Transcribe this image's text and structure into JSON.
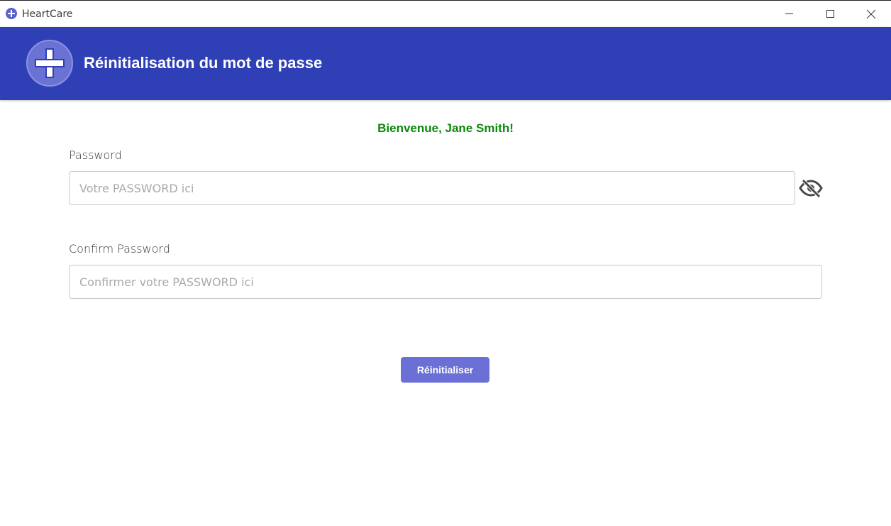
{
  "window": {
    "app_title": "HeartCare"
  },
  "header": {
    "title": "Réinitialisation du mot de passe"
  },
  "content": {
    "welcome_text": "Bienvenue, Jane Smith!",
    "password": {
      "label": "Password",
      "placeholder": "Votre PASSWORD ici",
      "value": ""
    },
    "confirm_password": {
      "label": "Confirm Password",
      "placeholder": "Confirmer votre PASSWORD ici",
      "value": ""
    },
    "submit_label": "Réinitialiser"
  },
  "colors": {
    "header_bg": "#2f40b7",
    "welcome": "#0a8a0a",
    "button_bg": "#6b70d6"
  },
  "icons": {
    "app": "plus-circle-icon",
    "logo": "medical-cross-icon",
    "toggle_visibility": "eye-slash-icon"
  }
}
